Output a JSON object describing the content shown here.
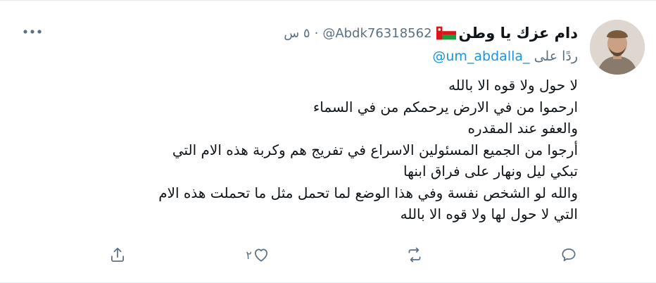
{
  "tweet": {
    "name": "دام عزك يا وطن",
    "handle": "@Abdk76318562",
    "separator": "·",
    "time": "٥ س",
    "reply_prefix": "ردًا على",
    "reply_to": "@um_abdalla_",
    "lines": [
      "لا حول ولا قوه الا بالله",
      "ارحموا من في الارض يرحمكم من في السماء",
      "والعفو عند المقدره",
      "أرجوا من الجميع المسئولين الاسراع في تفريج هم وكربة هذه الام التي",
      "تبكي ليل ونهار على فراق ابنها",
      "والله لو الشخص نفسة وفي هذا الوضع لما تحمل مثل ما تحملت هذه الام",
      "التي لا حول لها ولا قوه الا بالله"
    ],
    "actions": {
      "reply_count": "",
      "retweet_count": "",
      "like_count": "٢",
      "share_count": ""
    }
  },
  "icons": {
    "more": "more-horizontal-icon",
    "reply": "comment-icon",
    "retweet": "retweet-icon",
    "like": "heart-icon",
    "share": "share-icon",
    "flag": "oman-flag-icon"
  },
  "colors": {
    "secondary_text": "#5b7083",
    "link": "#1b95e0",
    "primary_text": "#0f1419"
  }
}
